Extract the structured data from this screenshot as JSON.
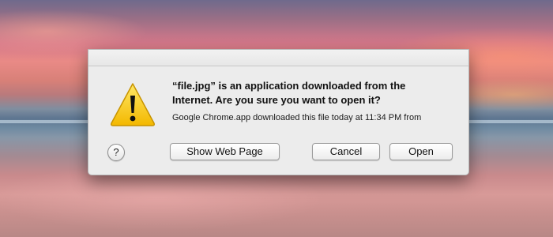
{
  "dialog": {
    "headline": "“file.jpg” is an application downloaded from the Internet. Are you sure you want to open it?",
    "subtext": "Google Chrome.app downloaded this file today at 11:34 PM from",
    "help_label": "?",
    "buttons": {
      "show_web_page": "Show Web Page",
      "cancel": "Cancel",
      "open": "Open"
    }
  },
  "icons": {
    "warning": "warning-icon",
    "help": "help-icon"
  },
  "colors": {
    "warning_fill": "#f6c400",
    "dialog_bg": "#ececec"
  }
}
